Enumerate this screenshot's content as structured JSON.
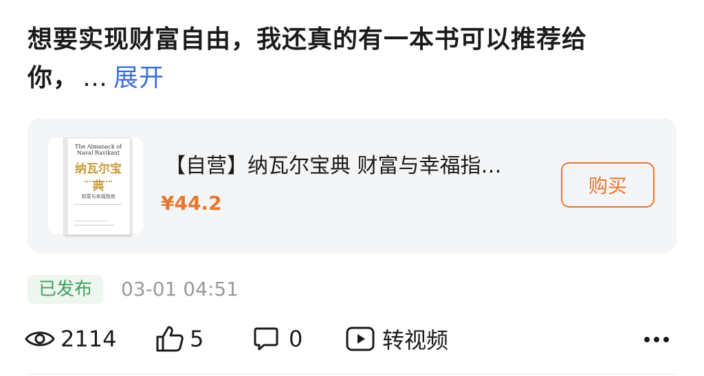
{
  "post": {
    "text": "想要实现财富自由，我还真的有一本书可以推荐给你，",
    "ellipsis": "…",
    "expand_label": "展开"
  },
  "product": {
    "title": "【自营】纳瓦尔宝典 财富与幸福指…",
    "price": "¥44.2",
    "buy_label": "购买",
    "cover": {
      "title_en": "The Almanack of Naval Ravikant",
      "title_cn": "纳瓦尔宝典",
      "subtitle_cn": "财富与幸福指南"
    }
  },
  "status": {
    "badge": "已发布",
    "timestamp": "03-01 04:51"
  },
  "actions": {
    "views": "2114",
    "likes": "5",
    "comments": "0",
    "convert_label": "转视频"
  },
  "colors": {
    "accent": "#e8762c",
    "link": "#3a6fd8",
    "status_green": "#3fa35e",
    "card_bg": "#f4f5f7"
  }
}
